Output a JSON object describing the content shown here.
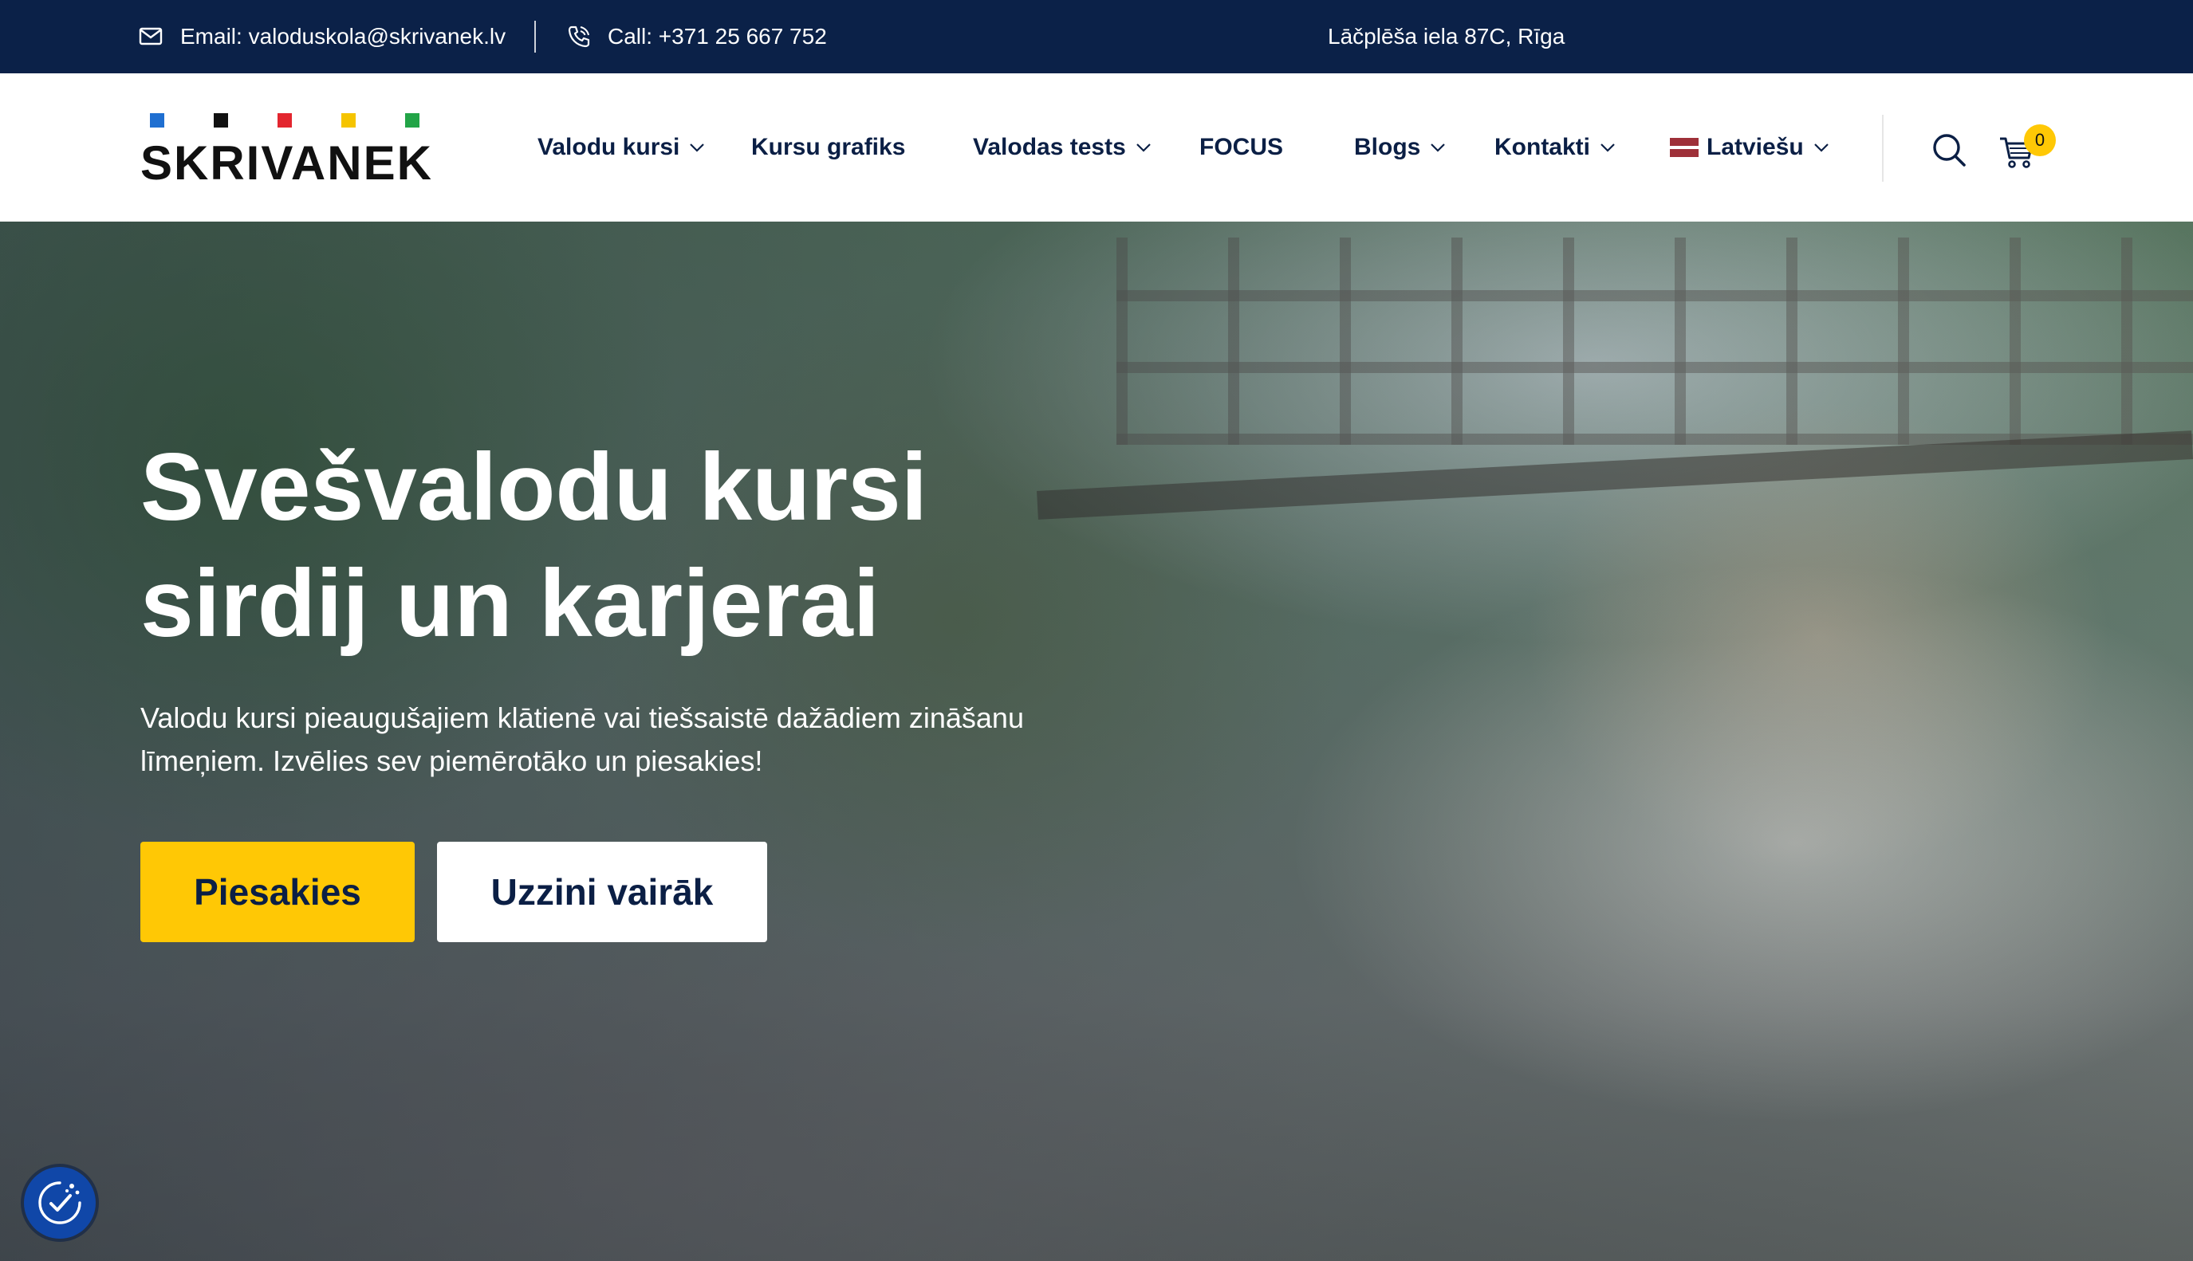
{
  "topbar": {
    "email": "Email: valoduskola@skrivanek.lv",
    "phone": "Call: +371 25 667 752",
    "address": "Lāčplēša iela 87C, Rīga"
  },
  "brand": {
    "logo_text": "SKRIVANEK",
    "dot_colors": [
      "#1f6fd1",
      "#111111",
      "#e3262f",
      "#f5c400",
      "#22a447"
    ]
  },
  "nav": {
    "items": [
      {
        "label": "Valodu kursi",
        "has_dropdown": true
      },
      {
        "label": "Kursu grafiks",
        "has_dropdown": false
      },
      {
        "label": "Valodas tests",
        "has_dropdown": true
      },
      {
        "label": "FOCUS",
        "has_dropdown": false
      },
      {
        "label": "Blogs",
        "has_dropdown": true
      },
      {
        "label": "Kontakti",
        "has_dropdown": true
      }
    ],
    "language": "Latviešu",
    "cart_count": "0"
  },
  "hero": {
    "title_line1": "Svešvalodu kursi",
    "title_line2": "sirdij un karjerai",
    "subtitle_line1": "Valodu kursi pieaugušajiem klātienē vai tiešsaistē dažādiem zināšanu",
    "subtitle_line2": "līmeņiem. Izvēlies sev piemērotāko un piesakies!",
    "primary_button": "Piesakies",
    "secondary_button": "Uzzini vairāk"
  },
  "colors": {
    "navy": "#0b2148",
    "accent_yellow": "#ffc805",
    "accessibility_blue": "#1047a8"
  }
}
